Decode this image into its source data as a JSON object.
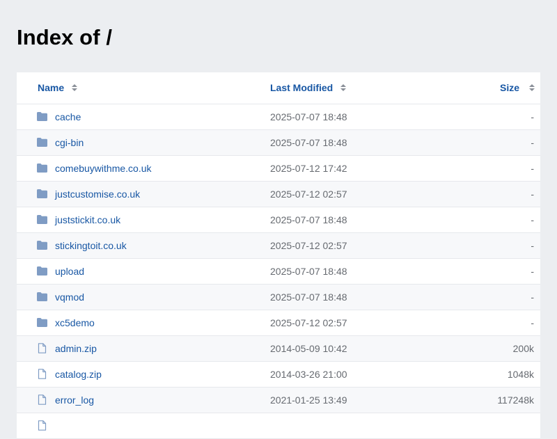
{
  "page": {
    "title": "Index of /"
  },
  "table": {
    "headers": {
      "name": "Name",
      "modified": "Last Modified",
      "size": "Size"
    },
    "rows": [
      {
        "type": "folder",
        "name": "cache",
        "modified": "2025-07-07 18:48",
        "size": "-"
      },
      {
        "type": "folder",
        "name": "cgi-bin",
        "modified": "2025-07-07 18:48",
        "size": "-"
      },
      {
        "type": "folder",
        "name": "comebuywithme.co.uk",
        "modified": "2025-07-12 17:42",
        "size": "-"
      },
      {
        "type": "folder",
        "name": "justcustomise.co.uk",
        "modified": "2025-07-12 02:57",
        "size": "-"
      },
      {
        "type": "folder",
        "name": "juststickit.co.uk",
        "modified": "2025-07-07 18:48",
        "size": "-"
      },
      {
        "type": "folder",
        "name": "stickingtoit.co.uk",
        "modified": "2025-07-12 02:57",
        "size": "-"
      },
      {
        "type": "folder",
        "name": "upload",
        "modified": "2025-07-07 18:48",
        "size": "-"
      },
      {
        "type": "folder",
        "name": "vqmod",
        "modified": "2025-07-07 18:48",
        "size": "-"
      },
      {
        "type": "folder",
        "name": "xc5demo",
        "modified": "2025-07-12 02:57",
        "size": "-"
      },
      {
        "type": "file",
        "name": "admin.zip",
        "modified": "2014-05-09 10:42",
        "size": "200k"
      },
      {
        "type": "file",
        "name": "catalog.zip",
        "modified": "2014-03-26 21:00",
        "size": "1048k"
      },
      {
        "type": "file",
        "name": "error_log",
        "modified": "2021-01-25 13:49",
        "size": "117248k"
      },
      {
        "type": "file",
        "name": "",
        "modified": "",
        "size": ""
      }
    ]
  },
  "colors": {
    "link": "#1857a4",
    "folder_icon": "#7f9cc4",
    "file_icon": "#7f9cc4",
    "background": "#eceef1"
  }
}
